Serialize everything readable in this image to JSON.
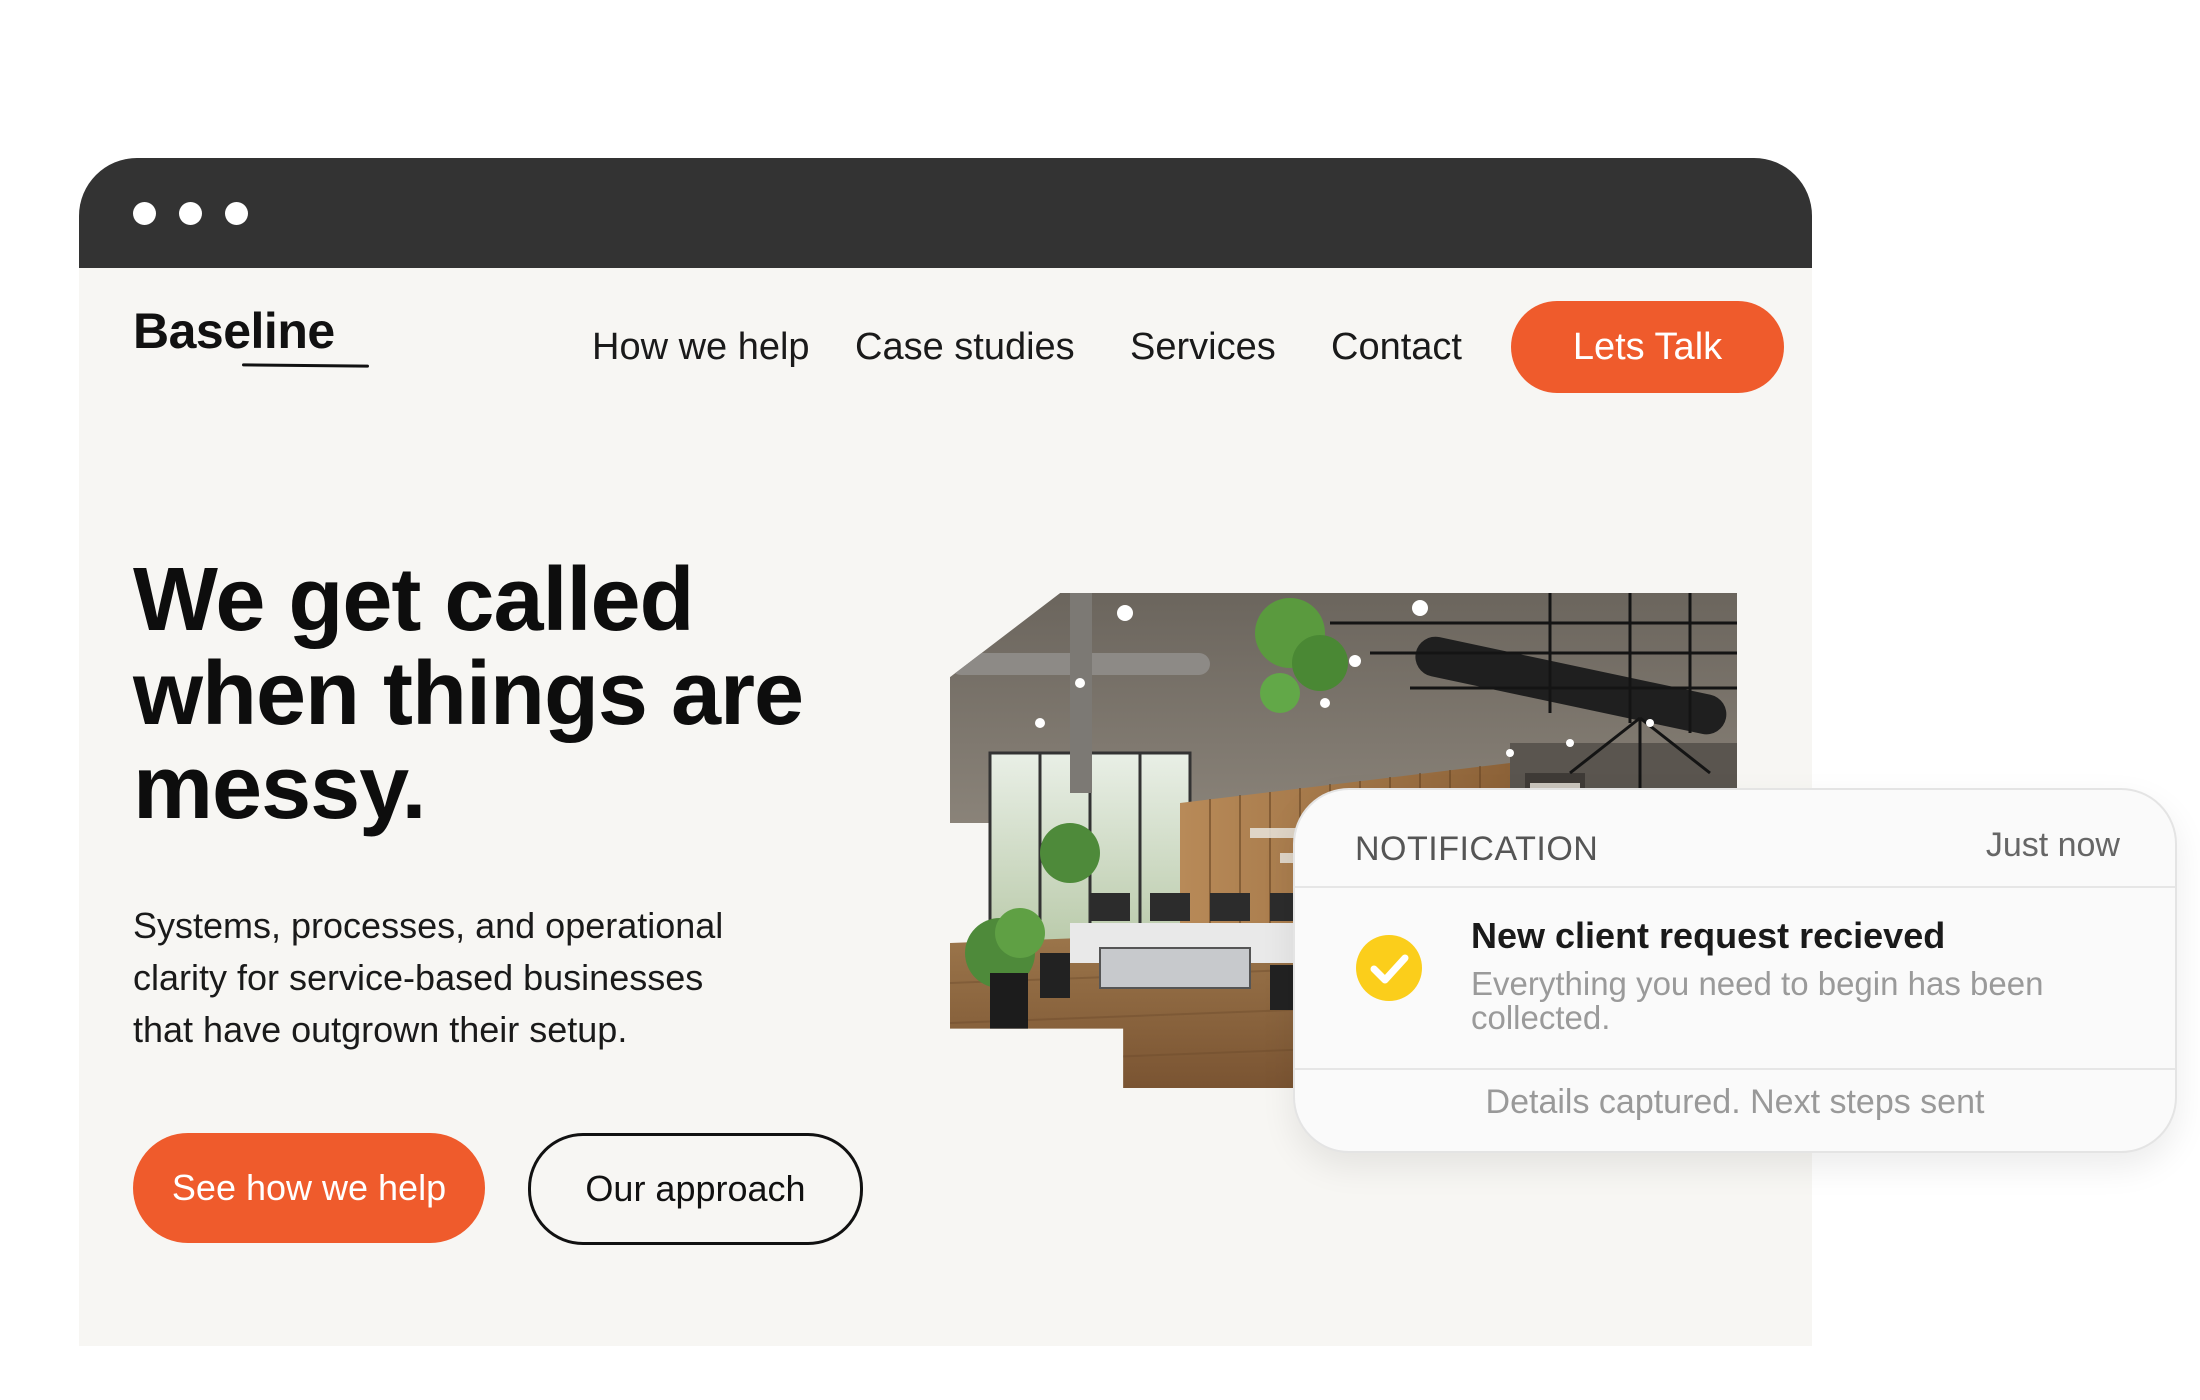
{
  "browser": {
    "window_controls": [
      "dot",
      "dot",
      "dot"
    ]
  },
  "header": {
    "logo": "Baseline",
    "nav": [
      {
        "label": "How we help"
      },
      {
        "label": "Case studies"
      },
      {
        "label": "Services"
      },
      {
        "label": "Contact"
      }
    ],
    "cta_label": "Lets Talk"
  },
  "hero": {
    "headline_lines": [
      "We get called",
      "when things are",
      "messy."
    ],
    "subtext_lines": [
      "Systems, processes, and operational",
      "clarity for service-based businesses",
      "that have outgrown their setup."
    ],
    "primary_button": "See how we help",
    "secondary_button": "Our approach"
  },
  "notification": {
    "label": "NOTIFICATION",
    "time": "Just now",
    "icon": "check-circle-icon",
    "title": "New client request recieved",
    "body": "Everything you need to begin has been collected.",
    "footer": "Details captured. Next steps sent"
  },
  "colors": {
    "accent": "#ef5b2c",
    "titlebar": "#333333",
    "page_bg": "#f7f6f3",
    "check": "#fbce1b"
  }
}
